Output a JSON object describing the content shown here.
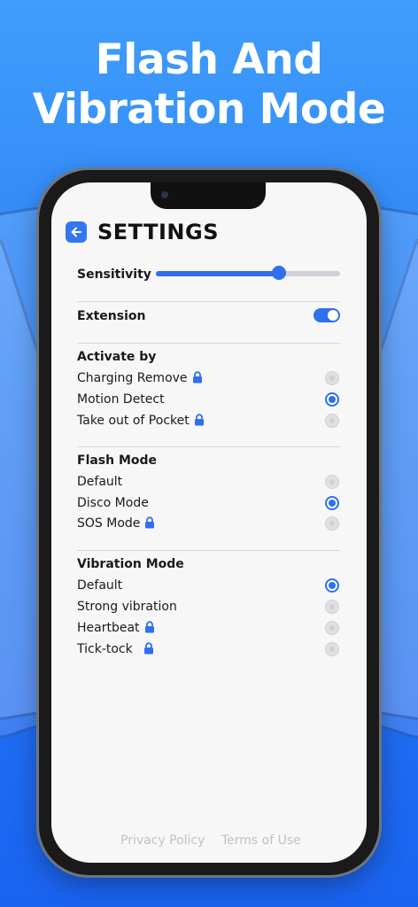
{
  "headline": {
    "line1": "Flash And",
    "line2": "Vibration Mode"
  },
  "settings": {
    "title": "SETTINGS",
    "sensitivity": {
      "label": "Sensitivity",
      "level": 0.67
    },
    "extension": {
      "label": "Extension",
      "enabled": true
    },
    "activate_by": {
      "label": "Activate by",
      "options": [
        {
          "label": "Charging Remove",
          "locked": true,
          "selected": false
        },
        {
          "label": "Motion Detect",
          "locked": false,
          "selected": true
        },
        {
          "label": "Take out of Pocket",
          "locked": true,
          "selected": false
        }
      ]
    },
    "flash_mode": {
      "label": "Flash Mode",
      "options": [
        {
          "label": "Default",
          "locked": false,
          "selected": false
        },
        {
          "label": "Disco Mode",
          "locked": false,
          "selected": true
        },
        {
          "label": "SOS Mode",
          "locked": true,
          "selected": false
        }
      ]
    },
    "vibration_mode": {
      "label": "Vibration Mode",
      "options": [
        {
          "label": "Default",
          "locked": false,
          "selected": true
        },
        {
          "label": "Strong vibration",
          "locked": false,
          "selected": false
        },
        {
          "label": "Heartbeat",
          "locked": true,
          "selected": false
        },
        {
          "label": "Tick-tock",
          "locked": true,
          "selected": false
        }
      ]
    }
  },
  "footer": {
    "privacy": "Privacy Policy",
    "terms": "Terms of Use"
  },
  "colors": {
    "accent": "#2f6ff0",
    "background_top": "#3f9dfb",
    "background_bottom": "#1a63f0"
  },
  "icons": {
    "back": "arrow-left-icon",
    "lock": "lock-icon"
  }
}
